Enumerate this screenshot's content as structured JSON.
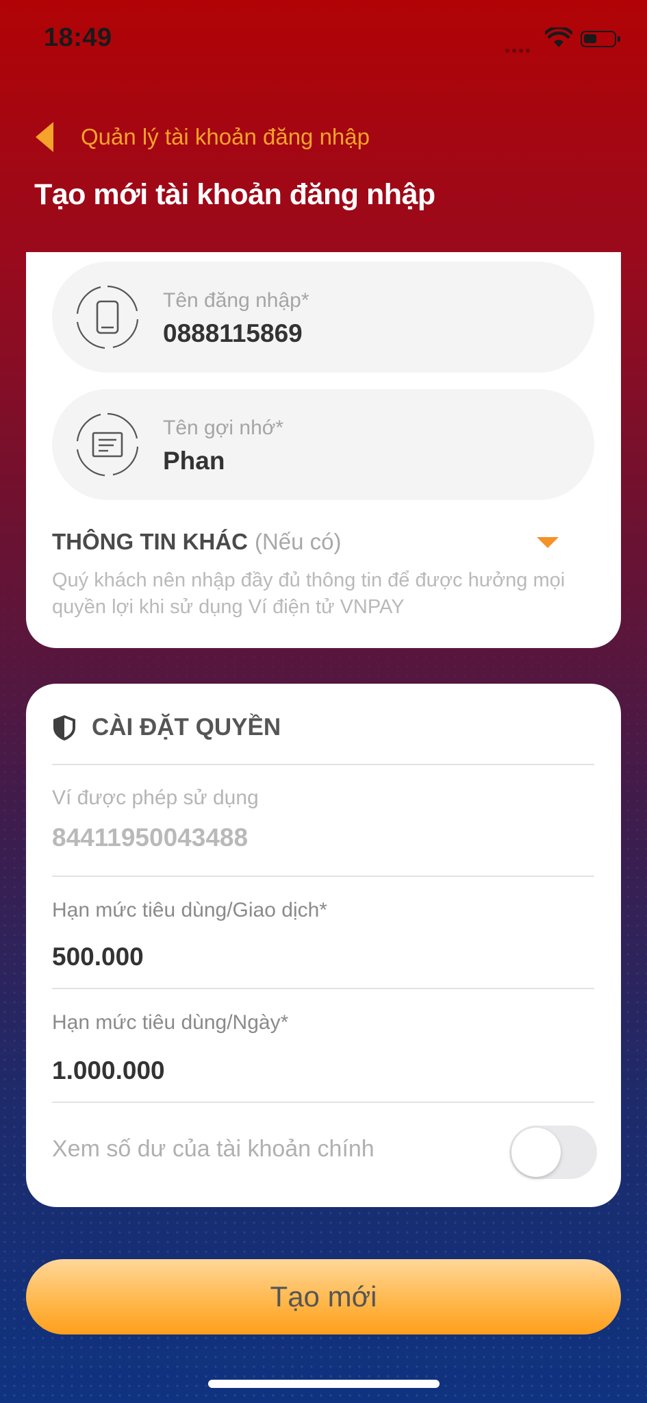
{
  "status_bar": {
    "time": "18:49"
  },
  "header": {
    "back_label": "Quản lý tài khoản đăng nhập",
    "title": "Tạo mới tài khoản đăng nhập"
  },
  "account_form": {
    "username": {
      "label": "Tên đăng nhập*",
      "value": "0888115869",
      "icon": "phone-icon"
    },
    "nickname": {
      "label": "Tên gợi nhớ*",
      "value": "Phan",
      "icon": "note-icon"
    },
    "other_info": {
      "title": "THÔNG TIN KHÁC",
      "optional": "(Nếu có)",
      "note": "Quý khách nên nhập đầy đủ thông tin để được hưởng mọi quyền lợi khi sử dụng Ví điện tử VNPAY"
    }
  },
  "permissions": {
    "title": "CÀI ĐẶT QUYỀN",
    "icon": "shield-icon",
    "wallet": {
      "label": "Ví được phép sử dụng",
      "value": "84411950043488"
    },
    "limit_per_transaction": {
      "label": "Hạn mức tiêu dùng/Giao dịch*",
      "value": "500.000"
    },
    "limit_per_day": {
      "label": "Hạn mức tiêu dùng/Ngày*",
      "value": "1.000.000"
    },
    "view_balance": {
      "label": "Xem số dư của tài khoản chính",
      "enabled": false
    }
  },
  "actions": {
    "create_label": "Tạo mới"
  },
  "colors": {
    "accent": "#f5a32a",
    "button": "#ffb84d",
    "header_red": "#b10306"
  }
}
